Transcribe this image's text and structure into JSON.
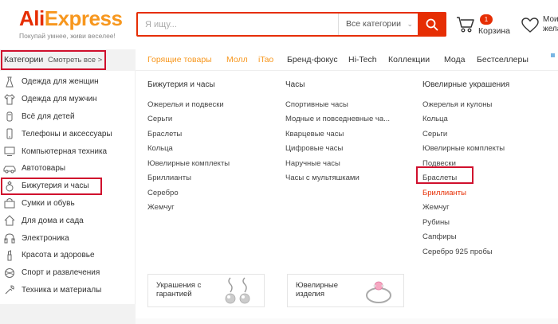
{
  "header": {
    "logo_part1": "Ali",
    "logo_part2": "Express",
    "tagline": "Покупай умнее, живи веселее!",
    "search_placeholder": "Я ищу...",
    "search_category": "Все категории",
    "cart_count": "1",
    "cart_label": "Корзина",
    "wishlist_label_line1": "Мои",
    "wishlist_label_line2": "жела"
  },
  "sidebar": {
    "title": "Категории",
    "see_all": "Смотреть все >",
    "items": [
      {
        "label": "Одежда для женщин",
        "icon": "dress-icon"
      },
      {
        "label": "Одежда для мужчин",
        "icon": "shirt-icon"
      },
      {
        "label": "Всё для детей",
        "icon": "baby-icon"
      },
      {
        "label": "Телефоны и аксессуары",
        "icon": "phone-icon"
      },
      {
        "label": "Компьютерная техника",
        "icon": "computer-icon"
      },
      {
        "label": "Автотовары",
        "icon": "car-icon"
      },
      {
        "label": "Бижутерия и часы",
        "icon": "ring-icon"
      },
      {
        "label": "Сумки и обувь",
        "icon": "bag-icon"
      },
      {
        "label": "Для дома и сада",
        "icon": "house-icon"
      },
      {
        "label": "Электроника",
        "icon": "headphones-icon"
      },
      {
        "label": "Красота и здоровье",
        "icon": "lipstick-icon"
      },
      {
        "label": "Спорт и развлечения",
        "icon": "ball-icon"
      },
      {
        "label": "Техника и материалы",
        "icon": "tools-icon"
      }
    ]
  },
  "topnav": [
    "Горящие товары",
    "Молл",
    "iTao",
    "Бренд-фокус",
    "Hi-Tech",
    "Коллекции",
    "Мода",
    "Бестселлеры"
  ],
  "panel": {
    "columns": [
      {
        "title": "Бижутерия и часы",
        "links": [
          "Ожерелья и подвески",
          "Серьги",
          "Браслеты",
          "Кольца",
          "Ювелирные комплекты",
          "Бриллианты",
          "Серебро",
          "Жемчуг"
        ]
      },
      {
        "title": "Часы",
        "links": [
          "Спортивные часы",
          "Модные и повседневные ча...",
          "Кварцевые часы",
          "Цифровые часы",
          "Наручные часы",
          "Часы с мультяшками"
        ]
      },
      {
        "title": "Ювелирные украшения",
        "links": [
          "Ожерелья и кулоны",
          "Кольца",
          "Серьги",
          "Ювелирные комплекты",
          "Подвески",
          "Браслеты",
          "Бриллианты",
          "Жемчуг",
          "Рубины",
          "Сапфиры",
          "Серебро 925 пробы"
        ]
      }
    ],
    "promos": [
      {
        "line1": "Украшения с",
        "line2": "гарантией"
      },
      {
        "line1": "Ювелирные",
        "line2": "изделия"
      }
    ]
  },
  "colors": {
    "brand_red": "#e62e04",
    "brand_orange": "#f7971e",
    "highlight_box": "#d0102d"
  }
}
